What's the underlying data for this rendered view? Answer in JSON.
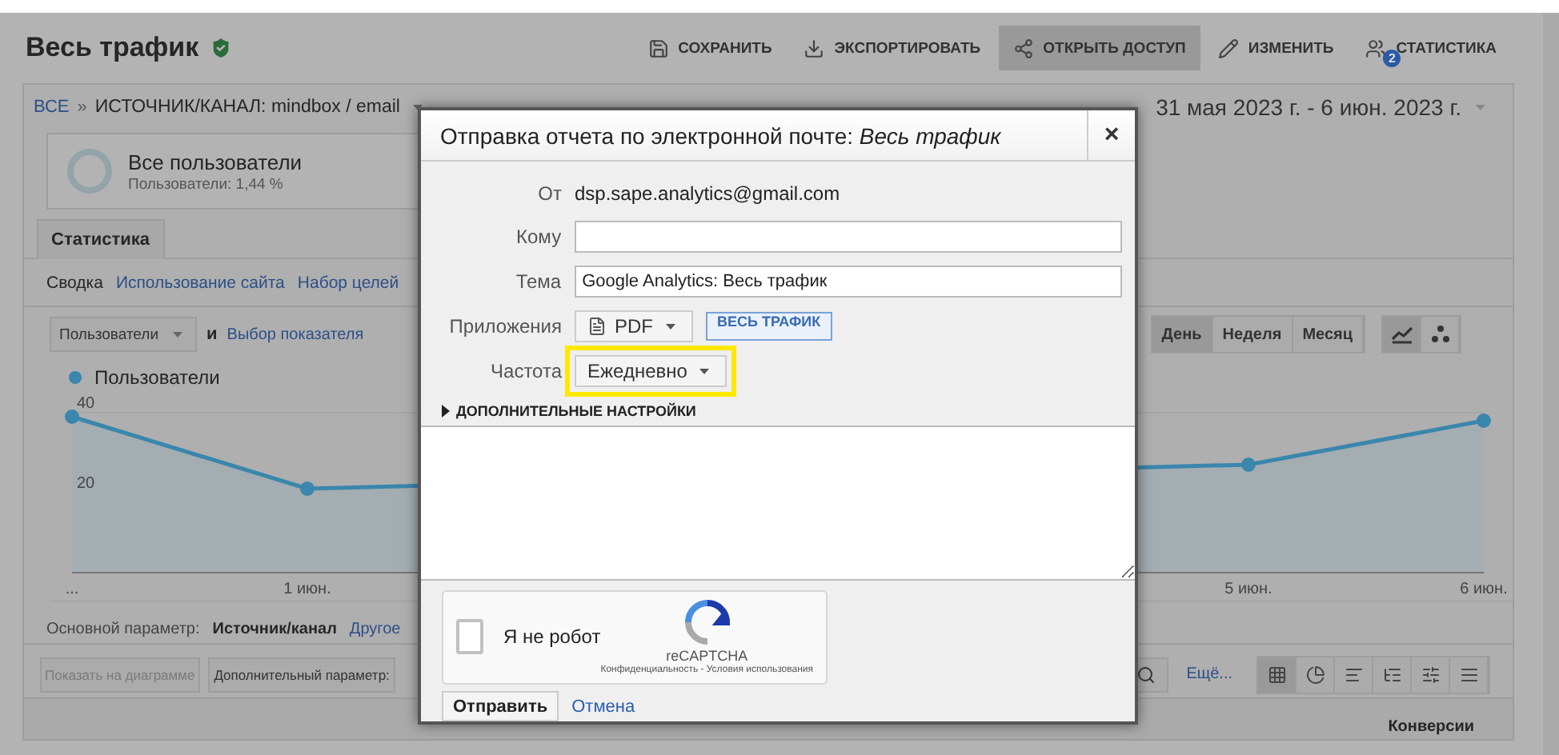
{
  "header": {
    "title": "Весь трафик",
    "verified": true,
    "actions": [
      {
        "label": "СОХРАНИТЬ",
        "kind": "save",
        "selected": false
      },
      {
        "label": "ЭКСПОРТИРОВАТЬ",
        "kind": "export",
        "selected": false
      },
      {
        "label": "ОТКРЫТЬ ДОСТУП",
        "kind": "share",
        "selected": true
      },
      {
        "label": "ИЗМЕНИТЬ",
        "kind": "edit",
        "selected": false
      },
      {
        "label": "СТАТИСТИКА",
        "kind": "insights",
        "badge": "2",
        "selected": false
      }
    ]
  },
  "breadcrumb": {
    "root": "ВСЕ",
    "separator": "»",
    "current": "ИСТОЧНИК/КАНАЛ: mindbox / email"
  },
  "date_range": "31 мая 2023 г. - 6 июн. 2023 г.",
  "segment": {
    "name": "Все пользователи",
    "share": "Пользователи: 1,44 %"
  },
  "tabs": [
    {
      "label": "Статистика",
      "selected": true
    }
  ],
  "subtabs": [
    "Сводка",
    "Использование сайта",
    "Набор целей"
  ],
  "metric": {
    "select": "Пользователи",
    "conjunction": "и",
    "link": "Выбор показателя"
  },
  "periods": [
    {
      "label": "День",
      "selected": true
    },
    {
      "label": "Неделя",
      "selected": false
    },
    {
      "label": "Месяц",
      "selected": false
    }
  ],
  "chart_types": [
    {
      "kind": "line",
      "selected": true
    },
    {
      "kind": "motion",
      "selected": false
    }
  ],
  "chart_data": {
    "type": "area",
    "x": [
      0,
      1,
      2,
      3,
      4,
      5,
      6
    ],
    "xlim": [
      0,
      6
    ],
    "series": [
      {
        "name": "Пользователи",
        "color": "#3a86ad",
        "values": [
          39,
          21,
          null,
          null,
          null,
          27,
          38
        ]
      }
    ],
    "ylim": [
      0,
      40
    ],
    "yticks": [
      20,
      40
    ],
    "xticks": [
      {
        "value": 0,
        "label": "..."
      },
      {
        "value": 1,
        "label": "1 июн."
      },
      {
        "value": 5,
        "label": "5 июн."
      },
      {
        "value": 6,
        "label": "6 июн."
      }
    ]
  },
  "primary_dimension": {
    "label": "Основной параметр:",
    "value": "Источник/канал",
    "other": "Другое"
  },
  "table_toolbar": {
    "plot_button": {
      "label": "Показать на диаграмме",
      "disabled": true
    },
    "secondary": "Дополнительный параметр:",
    "more": "Ещё...",
    "views": [
      {
        "kind": "table",
        "selected": true
      },
      {
        "kind": "pie",
        "selected": false
      },
      {
        "kind": "bars",
        "selected": false
      },
      {
        "kind": "compare",
        "selected": false
      },
      {
        "kind": "cloud",
        "selected": false
      },
      {
        "kind": "pivot",
        "selected": false
      }
    ]
  },
  "table": {
    "columns": [
      "Конверсии"
    ]
  },
  "dialog": {
    "title": "Отправка отчета по электронной почте: *Весь трафик*",
    "close": "×",
    "fields": [
      {
        "kind": "text",
        "label": "От",
        "value": "dsp.sape.analytics@gmail.com"
      },
      {
        "kind": "input",
        "label": "Кому"
      },
      {
        "kind": "input",
        "label": "Тема",
        "value": "Google Analytics: Весь трафик"
      },
      {
        "kind": "attachments",
        "label": "Приложения",
        "format": "PDF",
        "tag": "ВЕСЬ ТРАФИК"
      },
      {
        "kind": "dropdown",
        "label": "Частота",
        "value": "Ежедневно",
        "highlighted": true
      }
    ],
    "advanced": {
      "label": "ДОПОЛНИТЕЛЬНЫЕ НАСТРОЙКИ",
      "expanded": false
    },
    "captcha": {
      "checked": false,
      "label": "Я не робот",
      "brand": "reCAPTCHA",
      "terms": "Конфиденциальность - Условия использования"
    },
    "submit": "Отправить",
    "cancel": "Отмена"
  }
}
